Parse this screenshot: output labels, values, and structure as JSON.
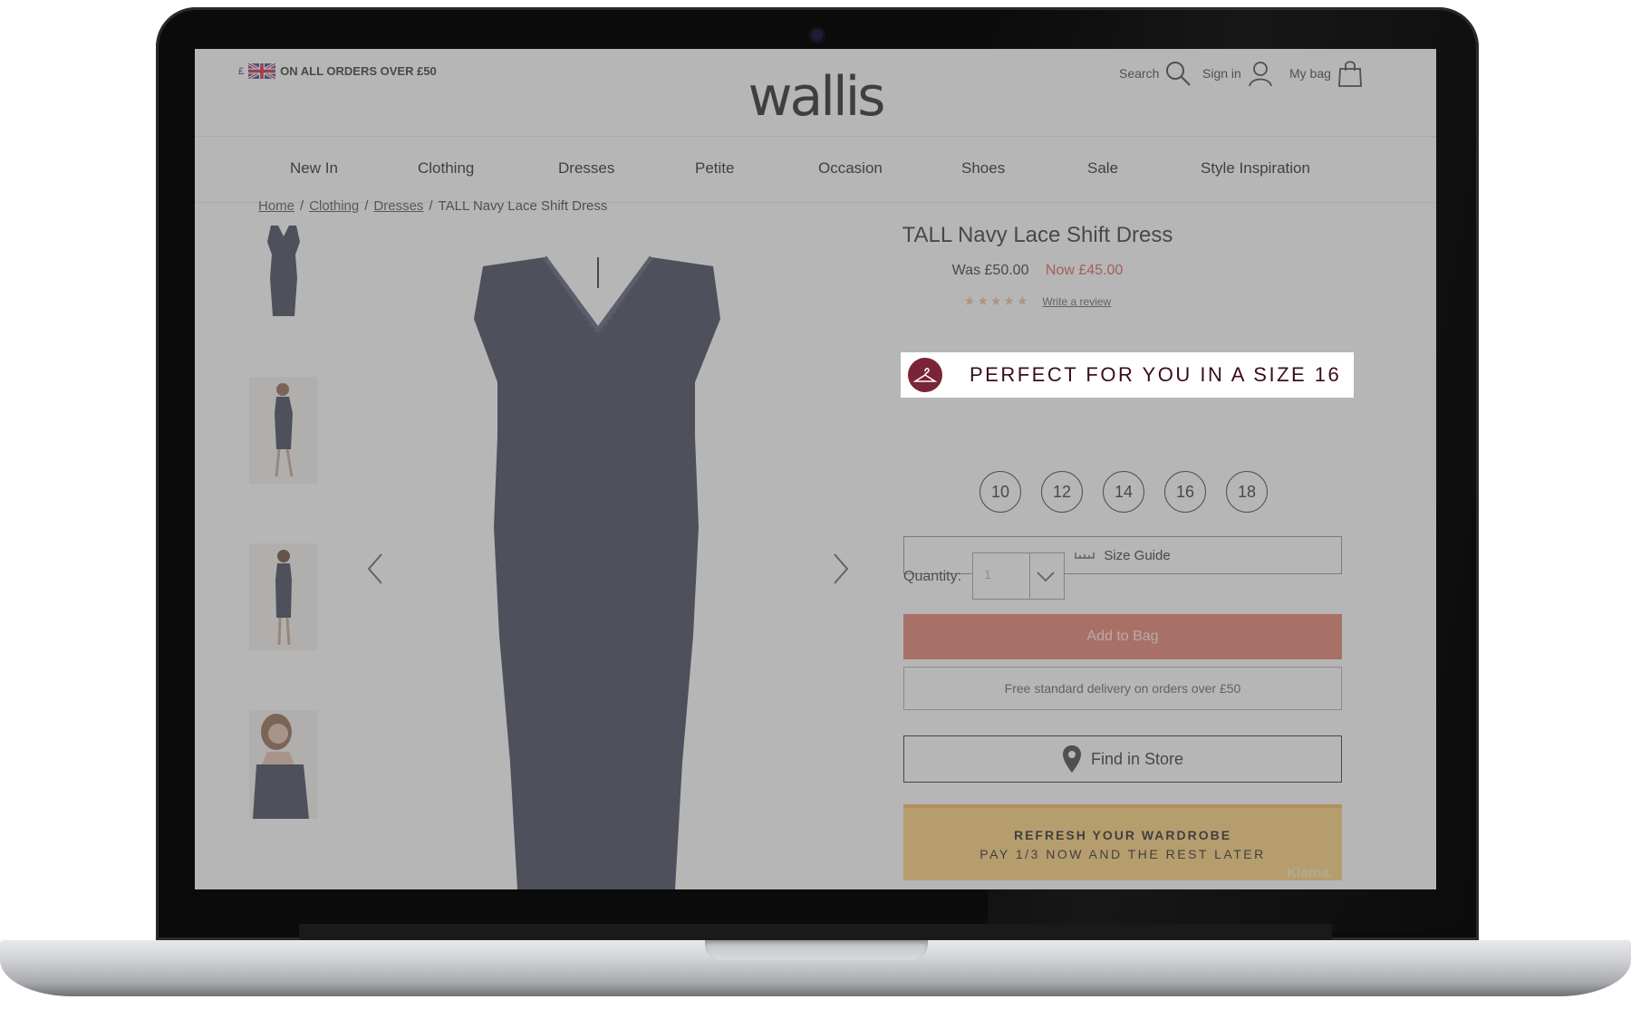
{
  "header": {
    "currency_symbol": "£",
    "promo_text": "ON ALL ORDERS OVER £50",
    "logo_text": "wallis",
    "search_label": "Search",
    "signin_label": "Sign in",
    "bag_label": "My bag"
  },
  "nav": {
    "items": [
      "New In",
      "Clothing",
      "Dresses",
      "Petite",
      "Occasion",
      "Shoes",
      "Sale",
      "Style Inspiration"
    ]
  },
  "breadcrumb": {
    "items": [
      "Home",
      "Clothing",
      "Dresses"
    ],
    "current": "TALL Navy Lace Shift Dress",
    "separator": "/"
  },
  "product": {
    "title": "TALL Navy Lace Shift Dress",
    "was_price": "Was £50.00",
    "now_price": "Now £45.00",
    "stars": "★★★★★",
    "review_link": "Write a review",
    "fit_message": "PERFECT FOR YOU IN A SIZE 16",
    "sizes": [
      "10",
      "12",
      "14",
      "16",
      "18"
    ],
    "size_guide_label": "Size Guide",
    "quantity_label": "Quantity:",
    "quantity_value": "1",
    "add_to_bag_label": "Add to Bag",
    "delivery_text": "Free standard delivery on orders over £50",
    "find_in_store_label": "Find in Store"
  },
  "klarna": {
    "line1": "REFRESH YOUR WARDROBE",
    "line2": "PAY 1/3 NOW AND THE REST LATER",
    "logo": "Klarna."
  },
  "colors": {
    "accent": "#e5735f",
    "sale_price": "#d9513a",
    "fit_icon": "#7a2437",
    "klarna": "#ffcd6b",
    "dress": "#2e3447"
  },
  "icons": {
    "search": "search-icon",
    "signin": "user-icon",
    "bag": "shopping-bag-icon",
    "fit": "hanger-icon",
    "size_guide": "ruler-icon",
    "find_in_store": "map-pin-icon",
    "prev": "chevron-left-icon",
    "next": "chevron-right-icon",
    "qty": "chevron-down-icon"
  }
}
